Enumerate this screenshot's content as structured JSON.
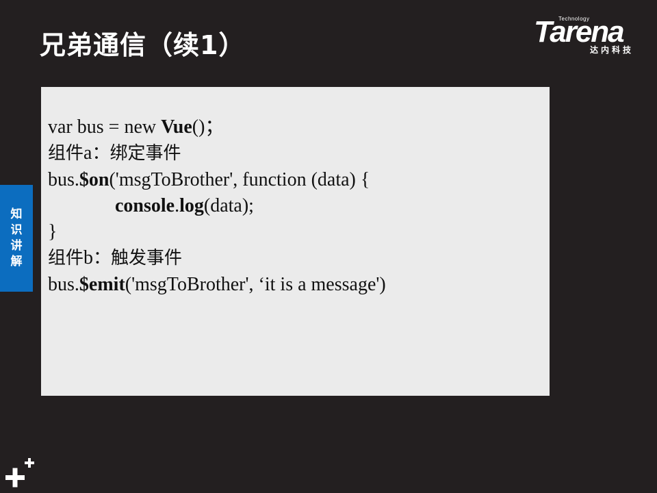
{
  "slide": {
    "title": "兄弟通信（续1）"
  },
  "logo": {
    "tagline": "Technology",
    "brand": "Tarena",
    "subtitle": "达内科技"
  },
  "side_tab": {
    "chars": [
      "知",
      "识",
      "讲",
      "解"
    ]
  },
  "code": {
    "line1": {
      "a": "var bus = new ",
      "b": "Vue",
      "c": "()；"
    },
    "line2": {
      "a": "组件",
      "b": "a",
      "c": "：绑定事件"
    },
    "line3": {
      "a": "bus.",
      "b": "$on",
      "c": "('msgToBrother',  function (data) {"
    },
    "line4": {
      "a": "console",
      "b": ".",
      "c": "log",
      "d": "(data);"
    },
    "line5": {
      "a": "}"
    },
    "line6": {
      "a": "组件",
      "b": "b",
      "c": "：触发事件"
    },
    "line7": {
      "a": "bus.",
      "b": "$emit",
      "c": "('msgToBrother',  ‘it is a message')"
    }
  },
  "colors": {
    "background": "#231f20",
    "code_box": "#ebebeb",
    "side_tab": "#0c6dbf",
    "text_light": "#ffffff"
  },
  "icons": [
    "plus-plus-icon"
  ]
}
